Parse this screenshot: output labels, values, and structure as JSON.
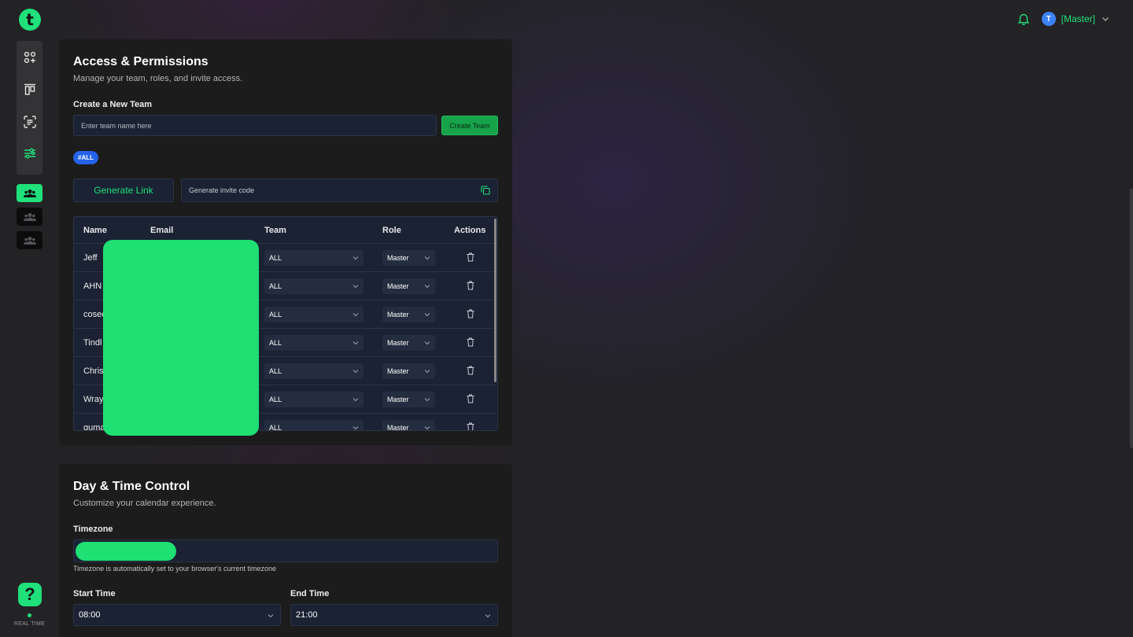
{
  "app": {
    "logo_letter": "t",
    "accent": "#1fe07a"
  },
  "sidebar": {
    "nav_icons": [
      "apps-add-icon",
      "kanban-icon",
      "scan-text-icon",
      "sliders-icon"
    ],
    "teams": [
      "team-icon",
      "team-icon",
      "team-icon"
    ],
    "help_label": "?",
    "realtime_label": "REAL TIME"
  },
  "header": {
    "avatar_letter": "T",
    "user_name": "[Master]"
  },
  "access": {
    "title": "Access & Permissions",
    "subtitle": "Manage your team, roles, and invite access.",
    "create_team_label": "Create a New Team",
    "team_name_placeholder": "Enter team name here",
    "create_team_button": "Create Team",
    "team_tag": "#ALL",
    "generate_link_button": "Generate Link",
    "invite_code_placeholder": "Generate invite code"
  },
  "members_table": {
    "columns": [
      "Name",
      "Email",
      "Team",
      "Role",
      "Actions"
    ],
    "rows": [
      {
        "name": "Jeff",
        "team": "ALL",
        "role": "Master"
      },
      {
        "name": "AHN",
        "team": "ALL",
        "role": "Master"
      },
      {
        "name": "cosec",
        "team": "ALL",
        "role": "Master"
      },
      {
        "name": "Tindl",
        "team": "ALL",
        "role": "Master"
      },
      {
        "name": "Chris",
        "team": "ALL",
        "role": "Master"
      },
      {
        "name": "Wray",
        "team": "ALL",
        "role": "Master"
      },
      {
        "name": "guma",
        "team": "ALL",
        "role": "Master"
      }
    ]
  },
  "time_control": {
    "title": "Day & Time Control",
    "subtitle": "Customize your calendar experience.",
    "timezone_label": "Timezone",
    "timezone_note": "Timezone is automatically set to your browser's current timezone",
    "start_label": "Start Time",
    "start_value": "08:00",
    "end_label": "End Time",
    "end_value": "21:00"
  }
}
